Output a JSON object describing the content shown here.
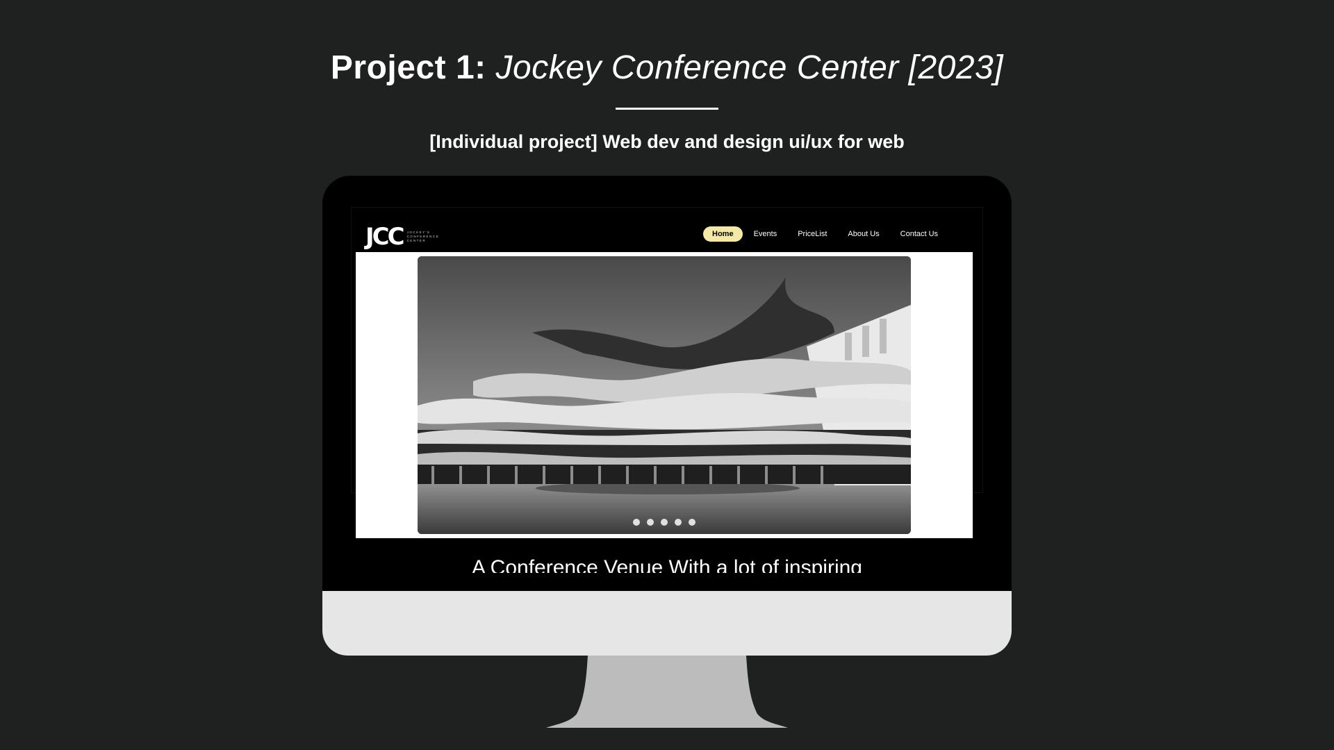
{
  "header": {
    "title_prefix": "Project 1:",
    "title_name": "Jockey Conference Center [2023]",
    "subtitle": "[Individual project] Web dev and design ui/ux for web"
  },
  "site": {
    "logo_mark": "JCC",
    "logo_lines": [
      "JOCKEY'S",
      "CONFERENCE",
      "CENTER"
    ],
    "nav": [
      {
        "label": "Home",
        "active": true
      },
      {
        "label": "Events",
        "active": false
      },
      {
        "label": "PriceList",
        "active": false
      },
      {
        "label": "About Us",
        "active": false
      },
      {
        "label": "Contact Us",
        "active": false
      }
    ],
    "hero_alt": "modern conference center building",
    "carousel_dots": 5,
    "tagline": "A Conference Venue With a lot of inspiring"
  },
  "colors": {
    "page_bg": "#1f2120",
    "active_nav_bg": "#f4e9a6",
    "monitor_chin": "#e6e6e6",
    "stand": "#bcbcbc"
  }
}
